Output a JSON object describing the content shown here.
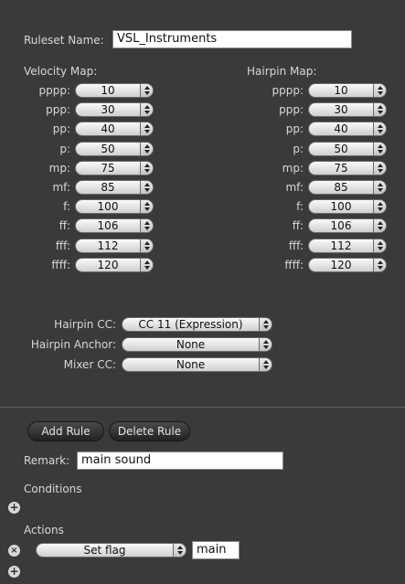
{
  "ruleset": {
    "label": "Ruleset Name:",
    "value": "VSL_Instruments"
  },
  "velocity_map": {
    "title": "Velocity Map:",
    "rows": [
      {
        "label": "pppp:",
        "value": "10"
      },
      {
        "label": "ppp:",
        "value": "30"
      },
      {
        "label": "pp:",
        "value": "40"
      },
      {
        "label": "p:",
        "value": "50"
      },
      {
        "label": "mp:",
        "value": "75"
      },
      {
        "label": "mf:",
        "value": "85"
      },
      {
        "label": "f:",
        "value": "100"
      },
      {
        "label": "ff:",
        "value": "106"
      },
      {
        "label": "fff:",
        "value": "112"
      },
      {
        "label": "ffff:",
        "value": "120"
      }
    ]
  },
  "hairpin_map": {
    "title": "Hairpin Map:",
    "rows": [
      {
        "label": "pppp:",
        "value": "10"
      },
      {
        "label": "ppp:",
        "value": "30"
      },
      {
        "label": "pp:",
        "value": "40"
      },
      {
        "label": "p:",
        "value": "50"
      },
      {
        "label": "mp:",
        "value": "75"
      },
      {
        "label": "mf:",
        "value": "85"
      },
      {
        "label": "f:",
        "value": "100"
      },
      {
        "label": "ff:",
        "value": "106"
      },
      {
        "label": "fff:",
        "value": "112"
      },
      {
        "label": "ffff:",
        "value": "120"
      }
    ]
  },
  "hairpin_cc": {
    "label": "Hairpin CC:",
    "value": "CC 11 (Expression)"
  },
  "hairpin_anchor": {
    "label": "Hairpin Anchor:",
    "value": "None"
  },
  "mixer_cc": {
    "label": "Mixer CC:",
    "value": "None"
  },
  "buttons": {
    "add_rule": "Add Rule",
    "delete_rule": "Delete Rule"
  },
  "remark": {
    "label": "Remark:",
    "value": "main sound"
  },
  "conditions": {
    "label": "Conditions"
  },
  "actions": {
    "label": "Actions",
    "action_type": "Set flag",
    "action_value": "main"
  },
  "icons": {
    "add": "plus-circle-icon",
    "remove": "x-circle-icon",
    "stepper": "up-down-arrows-icon"
  }
}
